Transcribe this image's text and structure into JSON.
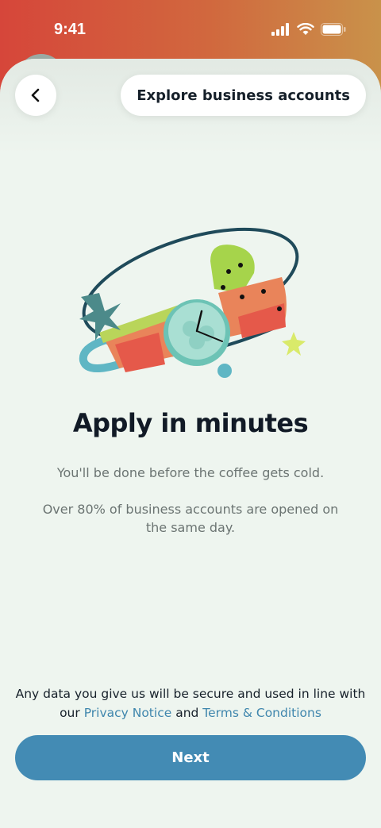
{
  "status_bar": {
    "time": "9:41"
  },
  "header": {
    "explore_label": "Explore business accounts"
  },
  "content": {
    "title": "Apply in minutes",
    "line1": "You'll be done before the coffee gets cold.",
    "line2": "Over 80% of business accounts are opened on the same day."
  },
  "legal": {
    "text_before": "Any data you give us will be secure and used in line with our ",
    "privacy_link": "Privacy Notice",
    "text_middle": " and ",
    "terms_link": "Terms & Conditions"
  },
  "footer": {
    "next_label": "Next"
  },
  "colors": {
    "accent": "#438bb4",
    "link": "#3f86ad",
    "background": "#eef5ef",
    "header_gradient_start": "#d6463a",
    "header_gradient_end": "#c9924a"
  },
  "icons": [
    "signal-icon",
    "wifi-icon",
    "battery-icon",
    "back-chevron-icon",
    "watch-illustration"
  ]
}
